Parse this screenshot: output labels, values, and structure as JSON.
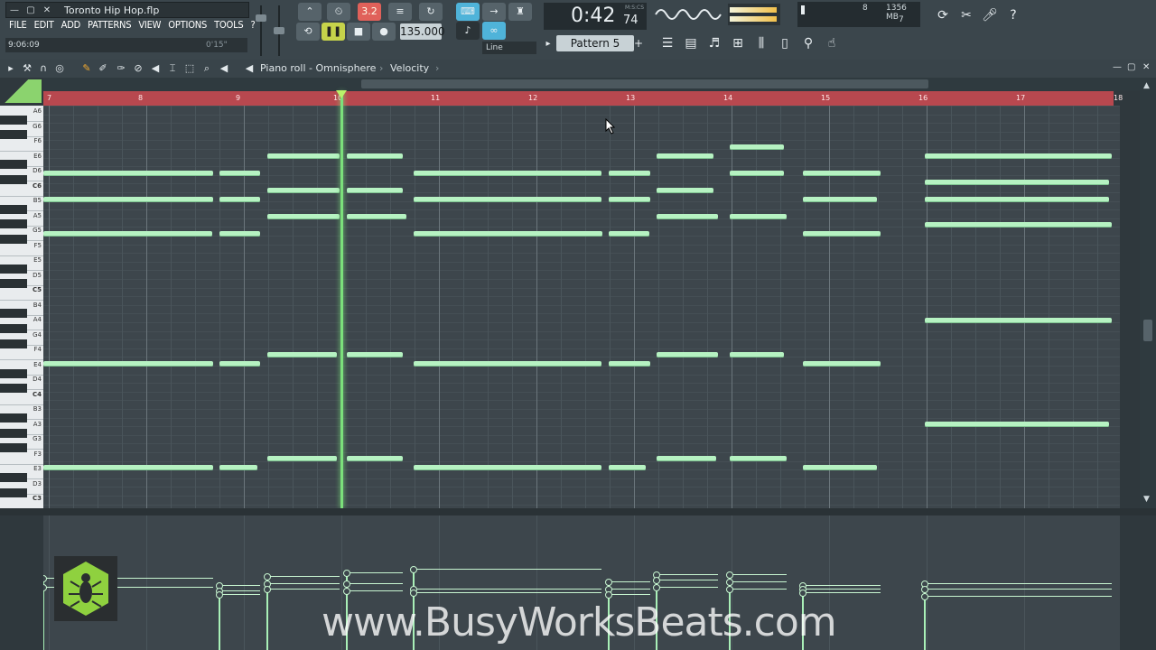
{
  "window": {
    "title": "Toronto Hip Hop.flp",
    "elapsed": "9:06:09",
    "hint_time": "0'15\""
  },
  "menu": [
    "FILE",
    "EDIT",
    "ADD",
    "PATTERNS",
    "VIEW",
    "OPTIONS",
    "TOOLS",
    "?"
  ],
  "transport": {
    "tempo": "135.000",
    "time_main": "0:42",
    "time_ms": "74",
    "time_caption": "M:S:CS",
    "snap_mode": "Line",
    "record_mode": "3.2"
  },
  "pattern": {
    "label": "Pattern 5"
  },
  "cpu": {
    "value": "8",
    "memory": "1356 MB",
    "polyphony": "7"
  },
  "pianoroll": {
    "title": "Piano roll - Omnisphere",
    "target": "Velocity"
  },
  "ruler": {
    "bars": [
      "7",
      "8",
      "9",
      "10",
      "11",
      "12",
      "13",
      "14",
      "15",
      "16",
      "17",
      "18"
    ]
  },
  "keys": {
    "labels": [
      "A6",
      "G6",
      "F6",
      "E6",
      "D6",
      "C6",
      "B5",
      "A5",
      "G5",
      "F5",
      "E5",
      "D5",
      "C5",
      "B4",
      "A4",
      "G4",
      "F4",
      "E4",
      "D4",
      "C4",
      "B3",
      "A3",
      "G3",
      "F3",
      "E3",
      "D3",
      "C3"
    ]
  },
  "watermark": "www.BusyWorksBeats.com",
  "colors": {
    "ruler": "#b8484f",
    "note": "#b6f2c2",
    "playhead": "#7be07b",
    "background": "#3d464c"
  }
}
